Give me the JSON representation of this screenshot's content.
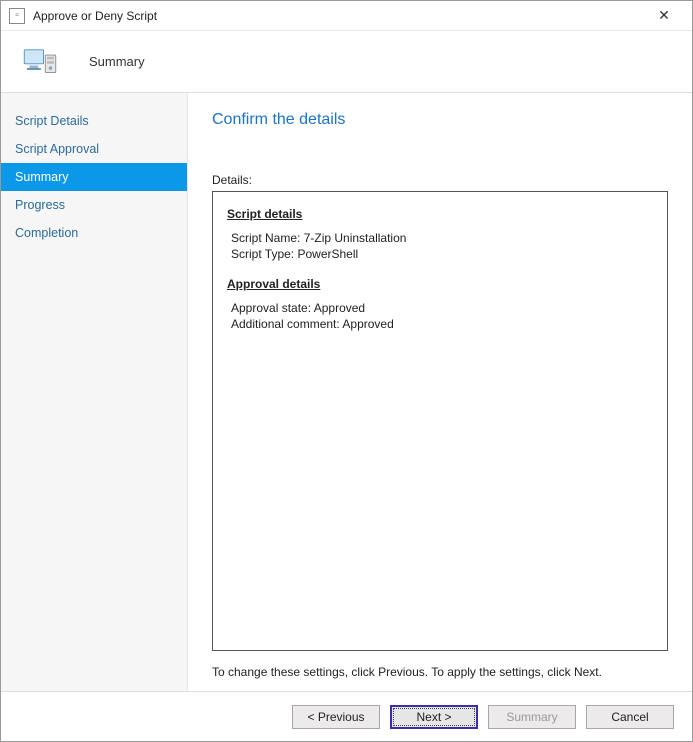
{
  "window": {
    "title": "Approve or Deny Script"
  },
  "banner": {
    "title": "Summary"
  },
  "sidebar": {
    "items": [
      {
        "label": "Script Details",
        "active": false
      },
      {
        "label": "Script Approval",
        "active": false
      },
      {
        "label": "Summary",
        "active": true
      },
      {
        "label": "Progress",
        "active": false
      },
      {
        "label": "Completion",
        "active": false
      }
    ]
  },
  "main": {
    "heading": "Confirm the details",
    "details_label": "Details:",
    "sections": {
      "script_details": {
        "title": "Script details",
        "script_name_label": "Script Name:",
        "script_name_value": "7-Zip Uninstallation",
        "script_type_label": "Script Type:",
        "script_type_value": "PowerShell"
      },
      "approval_details": {
        "title": "Approval details",
        "approval_state_label": "Approval state:",
        "approval_state_value": "Approved",
        "additional_comment_label": "Additional comment:",
        "additional_comment_value": "Approved"
      }
    },
    "hint": "To change these settings, click Previous. To apply the settings, click Next."
  },
  "footer": {
    "previous": "< Previous",
    "next": "Next >",
    "summary": "Summary",
    "cancel": "Cancel"
  }
}
